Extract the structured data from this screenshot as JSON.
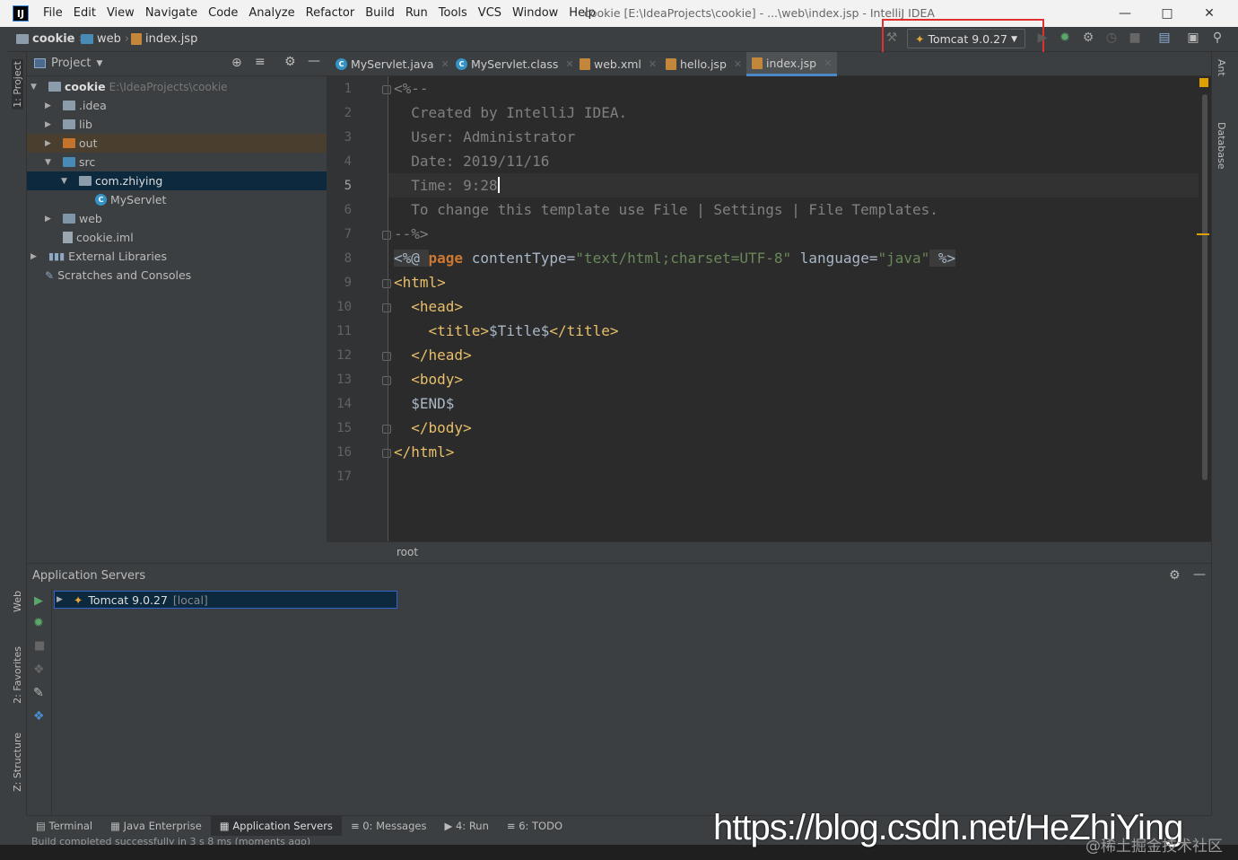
{
  "app": {
    "menu": [
      "File",
      "Edit",
      "View",
      "Navigate",
      "Code",
      "Analyze",
      "Refactor",
      "Build",
      "Run",
      "Tools",
      "VCS",
      "Window",
      "Help"
    ],
    "window_title": "cookie [E:\\IdeaProjects\\cookie] - ...\\web\\index.jsp - IntelliJ IDEA"
  },
  "breadcrumb": [
    "cookie",
    "web",
    "index.jsp"
  ],
  "run_config": {
    "label": "Tomcat 9.0.27"
  },
  "left_stripe": {
    "project": "1: Project",
    "web": "Web",
    "favorites": "2: Favorites",
    "structure": "Z: Structure"
  },
  "right_stripe": {
    "ant": "Ant",
    "database": "Database"
  },
  "project_panel": {
    "title": "Project",
    "tree": [
      {
        "label": "cookie",
        "path": "E:\\IdeaProjects\\cookie"
      },
      {
        "label": ".idea"
      },
      {
        "label": "lib"
      },
      {
        "label": "out"
      },
      {
        "label": "src"
      },
      {
        "label": "com.zhiying"
      },
      {
        "label": "MyServlet"
      },
      {
        "label": "web"
      },
      {
        "label": "cookie.iml"
      },
      {
        "label": "External Libraries"
      },
      {
        "label": "Scratches and Consoles"
      }
    ]
  },
  "editor_tabs": [
    "MyServlet.java",
    "MyServlet.class",
    "web.xml",
    "hello.jsp",
    "index.jsp"
  ],
  "editor": {
    "lines": [
      "1",
      "2",
      "3",
      "4",
      "5",
      "6",
      "7",
      "8",
      "9",
      "10",
      "11",
      "12",
      "13",
      "14",
      "15",
      "16",
      "17"
    ],
    "code": {
      "l1": "<%--",
      "l2": "  Created by IntelliJ IDEA.",
      "l3": "  User: Administrator",
      "l4": "  Date: 2019/11/16",
      "l5": "  Time: 9:28",
      "l6": "  To change this template use File | Settings | File Templates.",
      "l7": "--%>",
      "l8a": "<%@ ",
      "l8b": "page",
      "l8c": " contentType=",
      "l8d": "\"text/html;charset=UTF-8\"",
      "l8e": " language=",
      "l8f": "\"java\"",
      "l8g": " %>",
      "l9": "<html>",
      "l10": "  <head>",
      "l11a": "    <title>",
      "l11b": "$Title$",
      "l11c": "</title>",
      "l12": "  </head>",
      "l13": "  <body>",
      "l14": "  $END$",
      "l15": "  </body>",
      "l16": "</html>"
    },
    "footer": "root"
  },
  "bottom_panel": {
    "title": "Application Servers",
    "server": {
      "name": "Tomcat 9.0.27",
      "tag": "[local]"
    }
  },
  "bottom_tabs": [
    "Terminal",
    "Java Enterprise",
    "Application Servers",
    "0: Messages",
    "4: Run",
    "6: TODO"
  ],
  "status": "Build completed successfully in 3 s 8 ms (moments ago)",
  "watermark": "https://blog.csdn.net/HeZhiYing",
  "watermark2": "@稀土掘金技术社区",
  "colors": {
    "accent": "#4a88c7",
    "highlight_box": "#e03030",
    "tag": "#e8bf6a",
    "string": "#6a8759",
    "keyword": "#cc7832",
    "comment": "#808080"
  }
}
